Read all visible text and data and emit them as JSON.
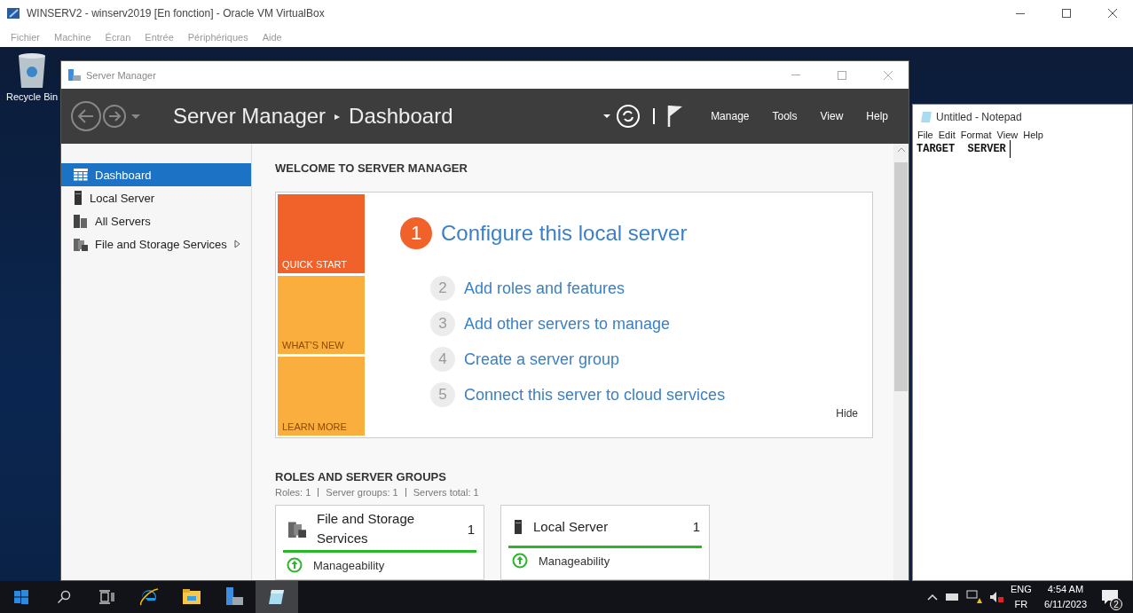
{
  "host_window": {
    "title": "WINSERV2 - winserv2019 [En fonction] - Oracle VM VirtualBox",
    "menu": [
      "Fichier",
      "Machine",
      "Écran",
      "Entrée",
      "Périphériques",
      "Aide"
    ]
  },
  "desktop_icons": [
    {
      "label": "Recycle Bin"
    }
  ],
  "server_manager": {
    "title": "Server Manager",
    "breadcrumb": {
      "root": "Server Manager",
      "separator": "▸",
      "page": "Dashboard"
    },
    "menu": [
      "Manage",
      "Tools",
      "View",
      "Help"
    ],
    "sidebar": [
      {
        "label": "Dashboard",
        "kind": "dashboard",
        "selected": true,
        "expandable": false
      },
      {
        "label": "Local Server",
        "kind": "server",
        "selected": false,
        "expandable": false
      },
      {
        "label": "All Servers",
        "kind": "servers",
        "selected": false,
        "expandable": false
      },
      {
        "label": "File and Storage Services",
        "kind": "storage",
        "selected": false,
        "expandable": true
      }
    ],
    "welcome": {
      "heading": "WELCOME TO SERVER MANAGER",
      "tiles": [
        {
          "label": "QUICK START",
          "color": "#f0622a"
        },
        {
          "label": "WHAT'S NEW",
          "color": "#f9ae3e"
        },
        {
          "label": "LEARN MORE",
          "color": "#f9ae3e"
        }
      ],
      "steps": [
        {
          "number": "1",
          "label": "Configure this local server",
          "kind": "current"
        },
        {
          "number": "2",
          "label": "Add roles and features",
          "kind": "step"
        },
        {
          "number": "3",
          "label": "Add other servers to manage",
          "kind": "step"
        },
        {
          "number": "4",
          "label": "Create a server group",
          "kind": "step"
        },
        {
          "number": "5",
          "label": "Connect this server to cloud services",
          "kind": "step"
        }
      ],
      "hide": "Hide"
    },
    "roles": {
      "heading": "ROLES AND SERVER GROUPS",
      "summary": [
        "Roles: 1",
        "Server groups: 1",
        "Servers total: 1"
      ],
      "cards": [
        {
          "title": "File and Storage Services",
          "kind": "storage",
          "count": "1",
          "status": "Manageability"
        },
        {
          "title": "Local Server",
          "kind": "server",
          "count": "1",
          "status": "Manageability"
        }
      ]
    }
  },
  "notepad": {
    "title": "Untitled - Notepad",
    "menu": [
      "File",
      "Edit",
      "Format",
      "View",
      "Help"
    ],
    "text": "TARGET  SERVER"
  },
  "taskbar": {
    "apps": [
      {
        "kind": "start",
        "active": false
      },
      {
        "kind": "search",
        "active": false
      },
      {
        "kind": "task-view",
        "active": false
      },
      {
        "kind": "browser",
        "active": false
      },
      {
        "kind": "explorer",
        "active": false
      },
      {
        "kind": "server-manager",
        "active": false
      },
      {
        "kind": "notepad",
        "active": true
      }
    ],
    "languages": [
      "ENG",
      "FR"
    ],
    "time": "4:54 AM",
    "date": "6/11/2023",
    "notifications": "2"
  }
}
